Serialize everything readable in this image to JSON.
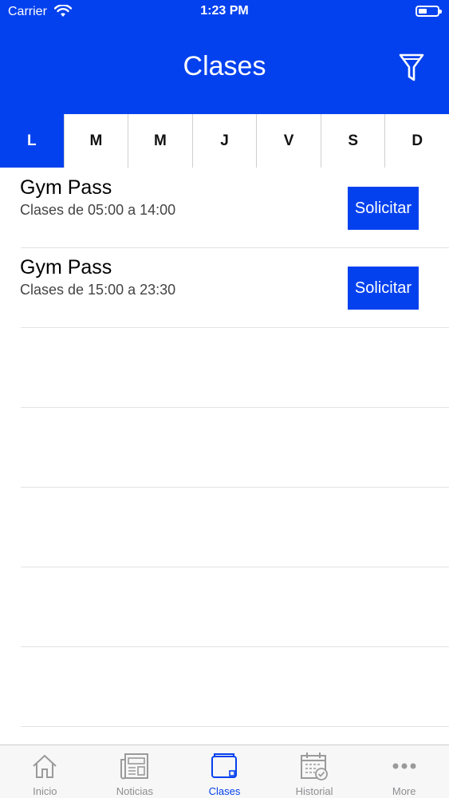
{
  "status_bar": {
    "carrier": "Carrier",
    "time": "1:23 PM"
  },
  "nav": {
    "title": "Clases",
    "filter_icon": "filter-icon"
  },
  "days": [
    "L",
    "M",
    "M",
    "J",
    "V",
    "S",
    "D"
  ],
  "selected_day": "L",
  "classes": [
    {
      "title": "Gym Pass",
      "subtitle": "Clases de 05:00 a 14:00",
      "action": "Solicitar"
    },
    {
      "title": "Gym Pass",
      "subtitle": "Clases de 15:00 a 23:30",
      "action": "Solicitar"
    }
  ],
  "tab_bar": {
    "items": [
      {
        "label": "Inicio",
        "icon": "home-icon"
      },
      {
        "label": "Noticias",
        "icon": "newspaper-icon"
      },
      {
        "label": "Clases",
        "icon": "wallet-icon"
      },
      {
        "label": "Historial",
        "icon": "calendar-check-icon"
      },
      {
        "label": "More",
        "icon": "more-icon"
      }
    ],
    "active": "Clases"
  },
  "colors": {
    "accent": "#0441EE",
    "inactive": "#8e8e93"
  }
}
